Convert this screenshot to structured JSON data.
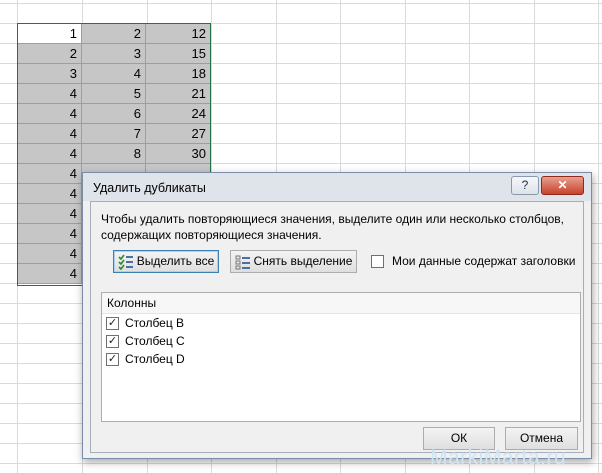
{
  "sheet": {
    "rows": [
      [
        "1",
        "2",
        "12"
      ],
      [
        "2",
        "3",
        "15"
      ],
      [
        "3",
        "4",
        "18"
      ],
      [
        "4",
        "5",
        "21"
      ],
      [
        "4",
        "6",
        "24"
      ],
      [
        "4",
        "7",
        "27"
      ],
      [
        "4",
        "8",
        "30"
      ],
      [
        "4",
        "",
        ""
      ],
      [
        "4",
        "",
        ""
      ],
      [
        "4",
        "",
        ""
      ],
      [
        "4",
        "",
        ""
      ],
      [
        "4",
        "",
        ""
      ],
      [
        "4",
        "",
        ""
      ]
    ],
    "selection_color": "#217346"
  },
  "dialog": {
    "title": "Удалить дубликаты",
    "help_label": "?",
    "close_label": "✕",
    "description": "Чтобы удалить повторяющиеся значения, выделите один или несколько столбцов, содержащих повторяющиеся значения.",
    "select_all_label": "Выделить все",
    "unselect_label": "Снять выделение",
    "headers_checkbox": {
      "label": "Мои данные содержат заголовки",
      "checked": false
    },
    "list_header": "Колонны",
    "columns": [
      {
        "label": "Столбец B",
        "checked": true
      },
      {
        "label": "Столбец C",
        "checked": true
      },
      {
        "label": "Столбец D",
        "checked": true
      }
    ],
    "ok_label": "ОК",
    "cancel_label": "Отмена"
  },
  "watermark": "MarkiMarta.ru",
  "icons": {
    "select_all": "checklist-icon",
    "unselect": "list-icon"
  }
}
